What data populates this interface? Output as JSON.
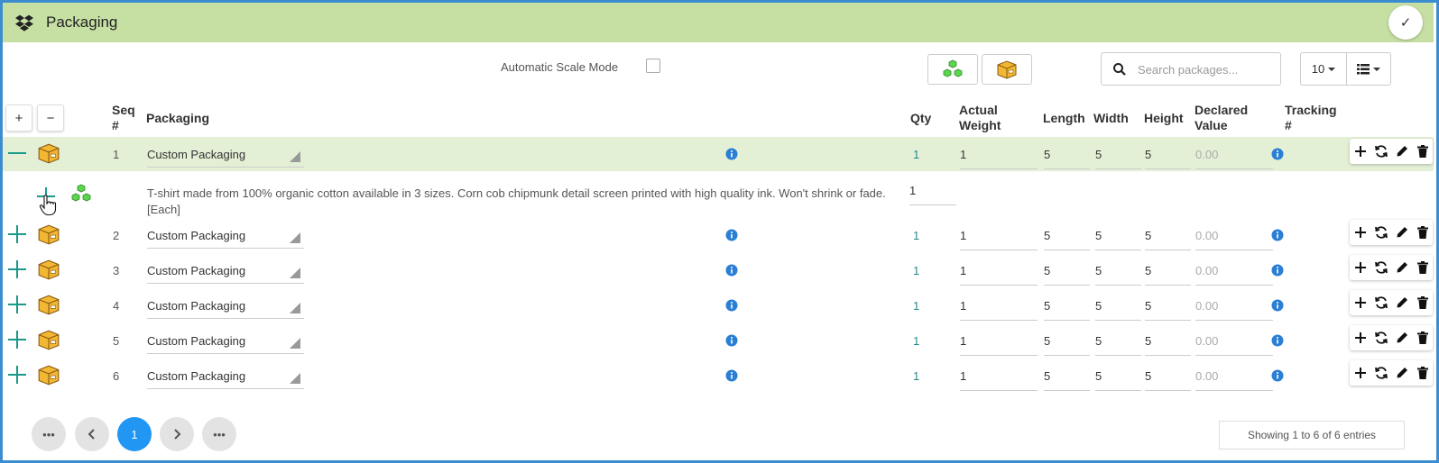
{
  "panel": {
    "title": "Packaging",
    "header_icon": "dropbox-icon",
    "confirm_icon": "check-icon"
  },
  "toolbar": {
    "auto_scale_label": "Automatic Scale Mode",
    "auto_scale_checked": false,
    "search_placeholder": "Search packages...",
    "page_size": "10"
  },
  "table": {
    "headers": {
      "seq": "Seq\n#",
      "packaging": "Packaging",
      "qty": "Qty",
      "actual_weight": "Actual\nWeight",
      "length": "Length",
      "width": "Width",
      "height": "Height",
      "declared_value": "Declared\nValue",
      "tracking": "Tracking\n#"
    },
    "rows": [
      {
        "seq": "1",
        "packaging": "Custom Packaging",
        "qty": "1",
        "weight": "1",
        "length": "5",
        "width": "5",
        "height": "5",
        "declared": "0.00",
        "expanded": true
      },
      {
        "seq": "2",
        "packaging": "Custom Packaging",
        "qty": "1",
        "weight": "1",
        "length": "5",
        "width": "5",
        "height": "5",
        "declared": "0.00",
        "expanded": false
      },
      {
        "seq": "3",
        "packaging": "Custom Packaging",
        "qty": "1",
        "weight": "1",
        "length": "5",
        "width": "5",
        "height": "5",
        "declared": "0.00",
        "expanded": false
      },
      {
        "seq": "4",
        "packaging": "Custom Packaging",
        "qty": "1",
        "weight": "1",
        "length": "5",
        "width": "5",
        "height": "5",
        "declared": "0.00",
        "expanded": false
      },
      {
        "seq": "5",
        "packaging": "Custom Packaging",
        "qty": "1",
        "weight": "1",
        "length": "5",
        "width": "5",
        "height": "5",
        "declared": "0.00",
        "expanded": false
      },
      {
        "seq": "6",
        "packaging": "Custom Packaging",
        "qty": "1",
        "weight": "1",
        "length": "5",
        "width": "5",
        "height": "5",
        "declared": "0.00",
        "expanded": false
      }
    ],
    "item": {
      "description": "T-shirt made from 100% organic cotton available in 3 sizes. Corn cob chipmunk detail screen printed with high quality ink. Won't shrink or fade. [Each]",
      "qty": "1"
    }
  },
  "pagination": {
    "first": "•••",
    "current": "1",
    "last": "•••",
    "entries_text": "Showing 1 to 6 of 6 entries"
  },
  "colors": {
    "header_bg": "#c6e0a3",
    "expanded_row_bg": "#e4f0d6",
    "accent_teal": "#1a9a8a",
    "page_active": "#2196f3",
    "info_blue": "#2a7fd4",
    "frame": "#3c8dcf"
  }
}
